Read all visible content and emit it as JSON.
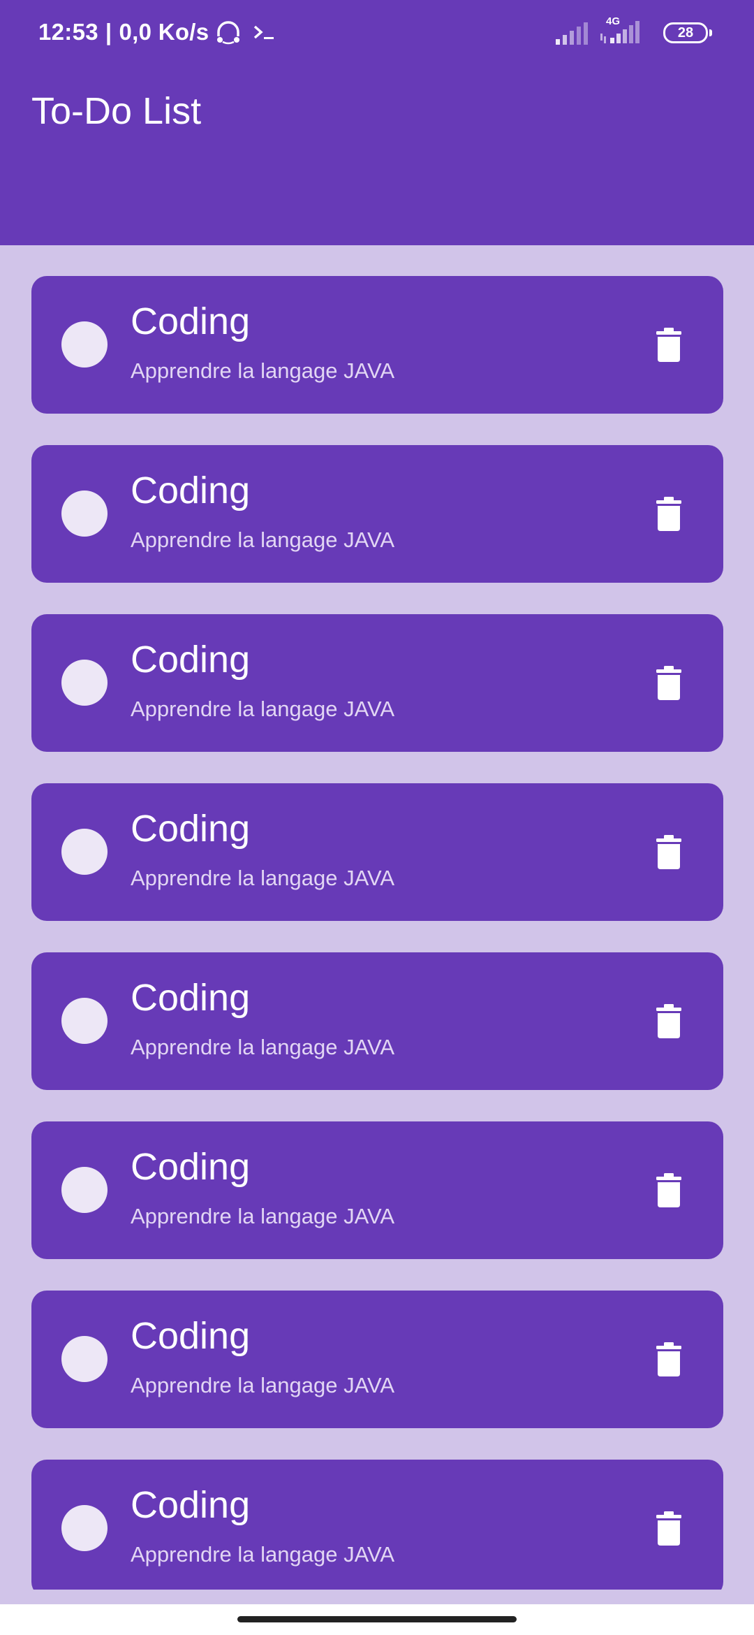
{
  "status_bar": {
    "time": "12:53",
    "separator": "|",
    "net_speed": "0,0 Ko/s",
    "network_type": "4G",
    "battery": "28",
    "icons": [
      "headphones-icon",
      "terminal-icon",
      "signal-icon",
      "signal-4g-icon",
      "battery-icon"
    ]
  },
  "app_bar": {
    "title": "To-Do List"
  },
  "tasks": [
    {
      "title": "Coding",
      "description": "Apprendre la langage JAVA"
    },
    {
      "title": "Coding",
      "description": "Apprendre la langage JAVA"
    },
    {
      "title": "Coding",
      "description": "Apprendre la langage JAVA"
    },
    {
      "title": "Coding",
      "description": "Apprendre la langage JAVA"
    },
    {
      "title": "Coding",
      "description": "Apprendre la langage JAVA"
    },
    {
      "title": "Coding",
      "description": "Apprendre la langage JAVA"
    },
    {
      "title": "Coding",
      "description": "Apprendre la langage JAVA"
    },
    {
      "title": "Coding",
      "description": "Apprendre la langage JAVA"
    }
  ],
  "colors": {
    "primary": "#673ab7",
    "background": "#d1c4e9",
    "checkbox": "#ede7f6",
    "on_primary": "#ffffff"
  }
}
